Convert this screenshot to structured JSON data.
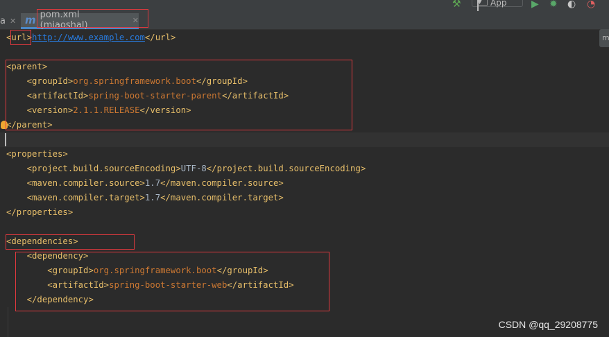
{
  "tabs": [
    {
      "label": "a",
      "active": false
    },
    {
      "label": "pom.xml (miaoshal)",
      "active": true
    }
  ],
  "toolbar": {
    "run_config": "App"
  },
  "editor": {
    "lines": [
      {
        "indent": "",
        "open": "url",
        "link": "http://www.example.com",
        "close": "url"
      },
      {
        "indent": "",
        "blank": true
      },
      {
        "indent": "",
        "open": "parent"
      },
      {
        "indent": "  ",
        "open": "groupId",
        "value": "org.springframework.boot",
        "close": "groupId"
      },
      {
        "indent": "  ",
        "open": "artifactId",
        "value": "spring-boot-starter-parent",
        "close": "artifactId"
      },
      {
        "indent": "  ",
        "open": "version",
        "value": "2.1.1.RELEASE",
        "close": "version"
      },
      {
        "indent": "",
        "close": "parent"
      },
      {
        "indent": "",
        "blank": true,
        "caret": true
      },
      {
        "indent": "",
        "open": "properties"
      },
      {
        "indent": "  ",
        "open": "project.build.sourceEncoding",
        "text": "UTF-8",
        "close": "project.build.sourceEncoding"
      },
      {
        "indent": "  ",
        "open": "maven.compiler.source",
        "text": "1.7",
        "close": "maven.compiler.source"
      },
      {
        "indent": "  ",
        "open": "maven.compiler.target",
        "text": "1.7",
        "close": "maven.compiler.target"
      },
      {
        "indent": "",
        "close": "properties"
      },
      {
        "indent": "",
        "blank": true
      },
      {
        "indent": "",
        "open": "dependencies"
      },
      {
        "indent": "  ",
        "open": "dependency"
      },
      {
        "indent": "    ",
        "open": "groupId",
        "value": "org.springframework.boot",
        "close": "groupId"
      },
      {
        "indent": "    ",
        "open": "artifactId",
        "value": "spring-boot-starter-web",
        "close": "artifactId"
      },
      {
        "indent": "  ",
        "close": "dependency"
      }
    ]
  },
  "watermark": "CSDN @qq_29208775",
  "colors": {
    "background": "#2b2b2b",
    "tag": "#e8bf6a",
    "value": "#cc7832",
    "text": "#a9b7c6",
    "link": "#287bde",
    "highlight_box": "#e0393e"
  }
}
